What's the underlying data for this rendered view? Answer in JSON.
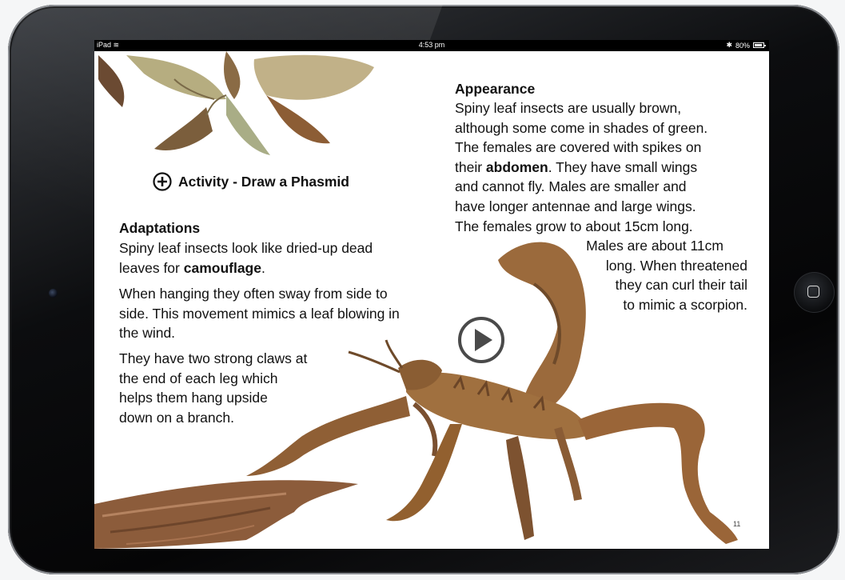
{
  "status_bar": {
    "device": "iPad",
    "time": "4:53 pm",
    "battery": "80%"
  },
  "activity": {
    "label": "Activity - Draw a Phasmid"
  },
  "adaptations": {
    "heading": "Adaptations",
    "p1_a": "Spiny leaf insects look like dried-up dead leaves for ",
    "p1_bold": "camouflage",
    "p1_b": ".",
    "p2": "When hanging they often sway from side to side.  This movement mimics a leaf blowing in the wind.",
    "p3_lines": [
      "They have two strong claws at",
      "the end of each leg which",
      "helps them hang upside",
      "down on a branch."
    ]
  },
  "appearance": {
    "heading": "Appearance",
    "lines_a": [
      "Spiny leaf insects are usually brown,",
      "although some come in shades of green.",
      "The females are covered with spikes on"
    ],
    "line_abd_a": "their ",
    "line_abd_bold": "abdomen",
    "line_abd_b": ".  They have small wings",
    "lines_b": [
      "and cannot fly.  Males are smaller and",
      "have longer antennae and large wings.",
      "The females grow to about 15cm long."
    ],
    "lines_right": [
      "Males are about 11cm",
      "long.  When threatened",
      "they can curl their tail",
      "to mimic a scorpion."
    ]
  },
  "page_number": "11",
  "colors": {
    "leaf_dark": "#6e4a2a",
    "leaf_mid": "#9a6a3f",
    "leaf_light": "#c29a6a",
    "dry_leaf": "#b2a87c"
  }
}
